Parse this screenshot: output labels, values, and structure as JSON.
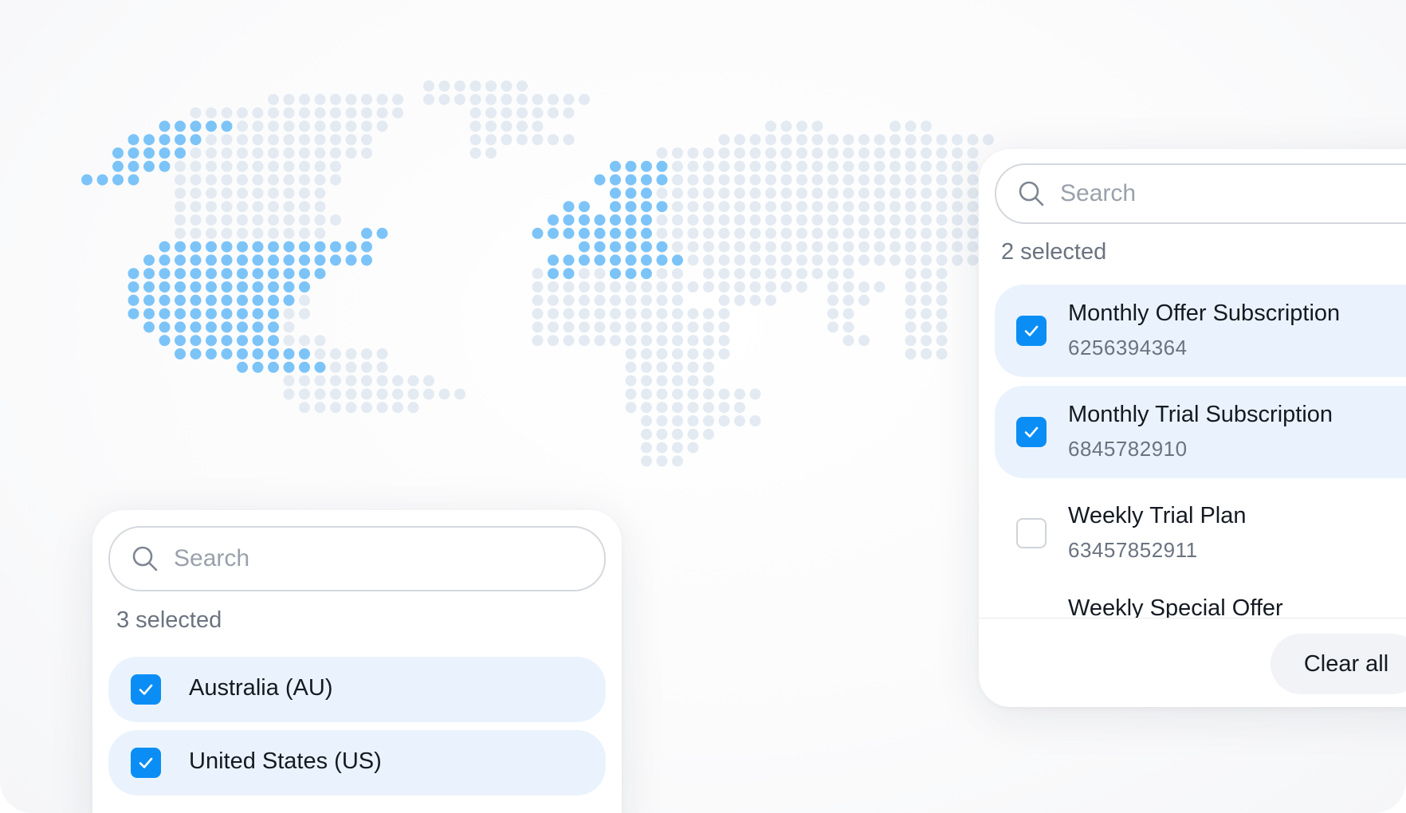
{
  "colors": {
    "accent": "#0a8ef5",
    "selected_row": "#eaf3fd",
    "map_highlight": "#7cc4f8",
    "map_dim": "#e3eaf2"
  },
  "icons": {
    "search": "search-icon",
    "check": "checkmark-icon"
  },
  "left_panel": {
    "search_placeholder": "Search",
    "selected_count": "3 selected",
    "items": [
      {
        "label": "Australia (AU)",
        "checked": true
      },
      {
        "label": "United States (US)",
        "checked": true
      }
    ]
  },
  "right_panel": {
    "search_placeholder": "Search",
    "selected_count": "2 selected",
    "items": [
      {
        "title": "Monthly Offer Subscription",
        "id": "6256394364",
        "checked": true
      },
      {
        "title": "Monthly Trial Subscription",
        "id": "6845782910",
        "checked": true
      },
      {
        "title": "Weekly Trial Plan",
        "id": "63457852911",
        "checked": false
      },
      {
        "title": "Weekly Special Offer",
        "id": "",
        "checked": false
      }
    ],
    "clear_label": "Clear all"
  }
}
